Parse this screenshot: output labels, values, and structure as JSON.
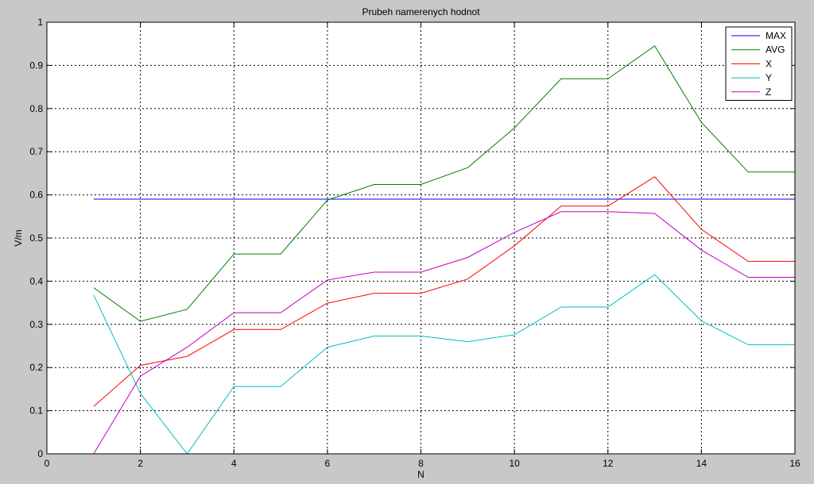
{
  "chart_data": {
    "type": "line",
    "title": "Prubeh namerenych hodnot",
    "xlabel": "N",
    "ylabel": "V/m",
    "xlim": [
      0,
      16
    ],
    "ylim": [
      0,
      1
    ],
    "xticks": [
      0,
      2,
      4,
      6,
      8,
      10,
      12,
      14,
      16
    ],
    "yticks": [
      0,
      0.1,
      0.2,
      0.3,
      0.4,
      0.5,
      0.6,
      0.7,
      0.8,
      0.9,
      1
    ],
    "ytick_labels": [
      "0",
      "0.1",
      "0.2",
      "0.3",
      "0.4",
      "0.5",
      "0.6",
      "0.7",
      "0.8",
      "0.9",
      "1"
    ],
    "grid": true,
    "legend_position": "top-right",
    "x": [
      1,
      2,
      3,
      4,
      5,
      6,
      7,
      8,
      9,
      10,
      11,
      12,
      13,
      14,
      15,
      16
    ],
    "series": [
      {
        "name": "MAX",
        "color": "#0000ff",
        "values": [
          0.59,
          0.59,
          0.59,
          0.59,
          0.59,
          0.59,
          0.59,
          0.59,
          0.59,
          0.59,
          0.59,
          0.59,
          0.59,
          0.59,
          0.59,
          0.59
        ]
      },
      {
        "name": "AVG",
        "color": "#008000",
        "values": [
          0.385,
          0.307,
          0.335,
          0.463,
          0.463,
          0.588,
          0.624,
          0.624,
          0.663,
          0.755,
          0.869,
          0.869,
          0.945,
          0.768,
          0.653,
          0.653
        ]
      },
      {
        "name": "X",
        "color": "#ff0000",
        "values": [
          0.11,
          0.205,
          0.226,
          0.288,
          0.288,
          0.349,
          0.372,
          0.372,
          0.405,
          0.482,
          0.574,
          0.574,
          0.642,
          0.52,
          0.446,
          0.446
        ]
      },
      {
        "name": "Y",
        "color": "#00bfbf",
        "values": [
          0.368,
          0.14,
          0.0,
          0.156,
          0.156,
          0.247,
          0.273,
          0.273,
          0.26,
          0.276,
          0.34,
          0.34,
          0.415,
          0.308,
          0.253,
          0.253
        ]
      },
      {
        "name": "Z",
        "color": "#bf00bf",
        "values": [
          0.0,
          0.18,
          0.247,
          0.327,
          0.327,
          0.403,
          0.421,
          0.421,
          0.455,
          0.513,
          0.561,
          0.561,
          0.557,
          0.472,
          0.409,
          0.409
        ]
      }
    ]
  }
}
